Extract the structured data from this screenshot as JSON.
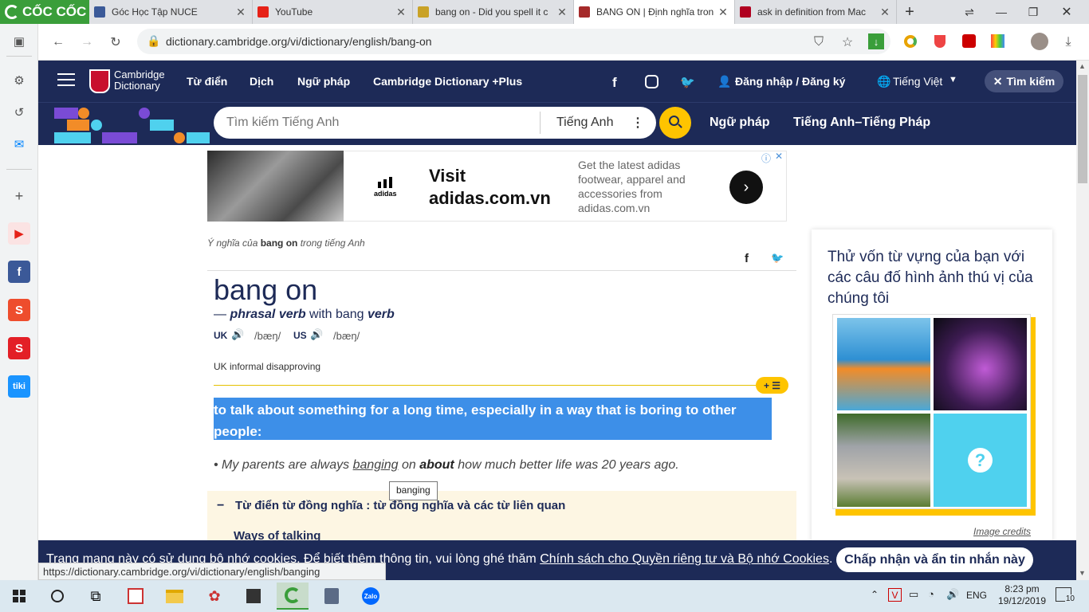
{
  "browser": {
    "brand": "CỐC CỐC",
    "tabs": [
      {
        "title": "Góc Học Tập NUCE",
        "color": "#3b5998"
      },
      {
        "title": "YouTube",
        "color": "#e62117"
      },
      {
        "title": "bang on - Did you spell it c",
        "color": "#8a6d3b"
      },
      {
        "title": "BANG ON | Định nghĩa tron",
        "color": "#a52a2a"
      },
      {
        "title": "ask in definition from Mac",
        "color": "#b00020"
      }
    ],
    "address": "dictionary.cambridge.org/vi/dictionary/english/bang-on",
    "address_host": "dictionary.cambridge.org",
    "address_path": "/vi/dictionary/english/bang-on",
    "status_url": "https://dictionary.cambridge.org/vi/dictionary/english/banging"
  },
  "site": {
    "logo_line1": "Cambridge",
    "logo_line2": "Dictionary",
    "nav": [
      "Từ điển",
      "Dịch",
      "Ngữ pháp",
      "Cambridge Dictionary +Plus"
    ],
    "login": "Đăng nhập / Đăng ký",
    "language": "Tiếng Việt",
    "search_toggle": "Tìm kiếm",
    "search_placeholder": "Tìm kiếm Tiếng Anh",
    "search_lang": "Tiếng Anh",
    "sub_links": [
      "Ngữ pháp",
      "Tiếng Anh–Tiếng Pháp"
    ]
  },
  "ad": {
    "headline1": "Visit",
    "headline2": "adidas.com.vn",
    "brand": "adidas",
    "body": "Get the latest adidas footwear, apparel and accessories from adidas.com.vn"
  },
  "entry": {
    "meaning_prefix": "Ý nghĩa của ",
    "meaning_word": "bang on",
    "meaning_suffix": " trong tiếng Anh",
    "headword": "bang on",
    "pos_dash": "— ",
    "pos": "phrasal verb",
    "with_text": " with bang ",
    "with_pos": "verb",
    "uk_label": "UK",
    "uk_ipa": "/bæŋ/",
    "us_label": "US",
    "us_ipa": "/bæŋ/",
    "register": "UK informal disapproving",
    "definition": "to talk about something for a long time, especially in a way that is boring to other people:",
    "example_pre": "My parents are always ",
    "example_link": "banging",
    "example_mid": " on ",
    "example_bold": "about",
    "example_post": " how much better life was 20 years ago.",
    "tooltip": "banging",
    "thesaurus_title": "Từ điển từ đồng nghĩa : từ đồng nghĩa và các từ liên quan",
    "thesaurus_sub": "Ways of talking"
  },
  "quiz": {
    "title": "Thử vốn từ vựng của bạn với các câu đố hình ảnh thú vị của chúng tôi",
    "credits": "Image credits",
    "question": "?"
  },
  "cookie": {
    "text": "Trang mạng này có sử dụng bộ nhớ cookies. Để biết thêm thông tin, vui lòng ghé thăm ",
    "link": "Chính sách cho Quyền riêng tư và Bộ nhớ Cookies",
    "end": ".",
    "button": "Chấp nhận và ẩn tin nhắn này"
  },
  "taskbar": {
    "lang": "ENG",
    "time": "8:23 pm",
    "date": "19/12/2019",
    "notif": "10"
  }
}
